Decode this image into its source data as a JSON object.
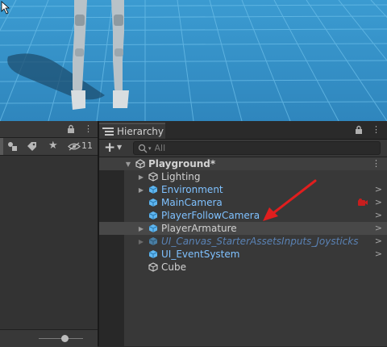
{
  "scene": {
    "background": "#3a8fc3"
  },
  "left_panel": {
    "toolbar_count": "11"
  },
  "hierarchy": {
    "tab_label": "Hierarchy",
    "search_placeholder": "All",
    "add_label": "+",
    "scene_name": "Playground*",
    "items": [
      {
        "label": "Lighting",
        "style": "white"
      },
      {
        "label": "Environment",
        "style": "blue"
      },
      {
        "label": "MainCamera",
        "style": "blue"
      },
      {
        "label": "PlayerFollowCamera",
        "style": "blue"
      },
      {
        "label": "PlayerArmature",
        "style": "white"
      },
      {
        "label": "UI_Canvas_StarterAssetsInputs_Joysticks",
        "style": "faded"
      },
      {
        "label": "UI_EventSystem",
        "style": "blue"
      },
      {
        "label": "Cube",
        "style": "white"
      }
    ]
  },
  "annotation": {
    "arrow_color": "#e01e1e"
  }
}
